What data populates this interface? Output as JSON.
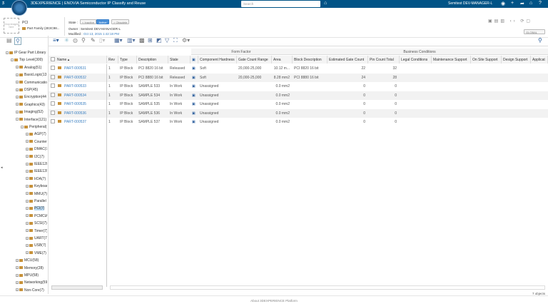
{
  "topbar": {
    "brand": "3DEXPERIENCE | ENOVIA Semiconductor IP Classify and Reuse",
    "search_placeholder": "Search",
    "user": "Semitest DEV-MANAGER-L",
    "color": "#005386"
  },
  "header": {
    "thumb_text": "Drop images here",
    "title": "PCI",
    "part_family": "Part Family (2E3C98...",
    "state_label": "State :",
    "states": [
      "< Inactive",
      "Active",
      "> Obsolete"
    ],
    "owner": "Owner : Semitest DEV-MANAGER-L",
    "modified_label": "Modified :",
    "modified": "Oct 13, 2015 1:42:18 PM",
    "global_label": "GLOBAL"
  },
  "tree": [
    {
      "label": "IP Gear Part Library",
      "level": 0
    },
    {
      "label": "Top Level(300)",
      "level": 1
    },
    {
      "label": "Analog(51)",
      "level": 2
    },
    {
      "label": "BasicLogic(13",
      "level": 2
    },
    {
      "label": "Communicatio",
      "level": 2
    },
    {
      "label": "DSP(45)",
      "level": 2
    },
    {
      "label": "Encryption(44",
      "level": 2
    },
    {
      "label": "Graphics(43)",
      "level": 2
    },
    {
      "label": "Imaging(52)",
      "level": 2
    },
    {
      "label": "Interface(121)",
      "level": 2
    },
    {
      "label": "Peripheral(",
      "level": 3
    },
    {
      "label": "AGP(7)",
      "level": 4
    },
    {
      "label": "Counter(",
      "level": 4
    },
    {
      "label": "DMAC(7",
      "level": 4
    },
    {
      "label": "I2C(7)",
      "level": 4
    },
    {
      "label": "IEEE128",
      "level": 4
    },
    {
      "label": "IEEE139",
      "level": 4
    },
    {
      "label": "IrDA(7)",
      "level": 4
    },
    {
      "label": "Keyboar",
      "level": 4
    },
    {
      "label": "MMU(7)",
      "level": 4
    },
    {
      "label": "Parallel",
      "level": 4
    },
    {
      "label": "PCI(7)",
      "level": 4,
      "selected": true
    },
    {
      "label": "PCMCIA",
      "level": 4
    },
    {
      "label": "SCSI(7)",
      "level": 4
    },
    {
      "label": "Timer(7)",
      "level": 4
    },
    {
      "label": "UART(7)",
      "level": 4
    },
    {
      "label": "USB(7)",
      "level": 4
    },
    {
      "label": "VME(7)",
      "level": 4
    },
    {
      "label": "MCU(58)",
      "level": 2
    },
    {
      "label": "Memory(28)",
      "level": 2
    },
    {
      "label": "MPU(58)",
      "level": 2
    },
    {
      "label": "Networking(59",
      "level": 2
    },
    {
      "label": "Non-Core(7)",
      "level": 2
    }
  ],
  "grid": {
    "groups": [
      "Form Factor",
      "Business Conditions"
    ],
    "columns": [
      "Name",
      "Rev",
      "Type",
      "Description",
      "State",
      "",
      "Component Hardness",
      "Gate Count Range",
      "Area",
      "Block Description",
      "Estimated Gate Count",
      "Pin Count Total",
      "Legal Conditions",
      "Maintenance Support",
      "On Site Support",
      "Design Support",
      "Applicat"
    ],
    "rows": [
      [
        "PART-000531",
        "1",
        "IP Block",
        "PCI 8820 16 bit",
        "Released",
        "",
        "Soft",
        "20,000-25,000",
        "10.12 m...",
        "PCI 8820 16 bit",
        "22",
        "32"
      ],
      [
        "PART-000532",
        "1",
        "IP Block",
        "PCI 8880 16 bit",
        "Released",
        "",
        "Soft",
        "20,000-25,000",
        "8.28 mm2",
        "PCI 8880 16 bit",
        "24",
        "28"
      ],
      [
        "PART-000533",
        "1",
        "IP Block",
        "SAMPLE 533",
        "In Work",
        "",
        "Unassigned",
        "",
        "0.0 mm2",
        "",
        "0",
        "0"
      ],
      [
        "PART-000534",
        "1",
        "IP Block",
        "SAMPLE 534",
        "In Work",
        "",
        "Unassigned",
        "",
        "0.0 mm2",
        "",
        "0",
        "0"
      ],
      [
        "PART-000535",
        "1",
        "IP Block",
        "SAMPLE 535",
        "In Work",
        "",
        "Unassigned",
        "",
        "0.0 mm2",
        "",
        "0",
        "0"
      ],
      [
        "PART-000536",
        "1",
        "IP Block",
        "SAMPLE 536",
        "In Work",
        "",
        "Unassigned",
        "",
        "0.0 mm2",
        "",
        "0",
        "0"
      ],
      [
        "PART-000537",
        "1",
        "IP Block",
        "SAMPLE 537",
        "In Work",
        "",
        "Unassigned",
        "",
        "0.0 mm2",
        "",
        "0",
        "0"
      ]
    ],
    "count": "7 objects"
  },
  "footer": {
    "about": "About 3DEXPERIENCE Platform"
  }
}
